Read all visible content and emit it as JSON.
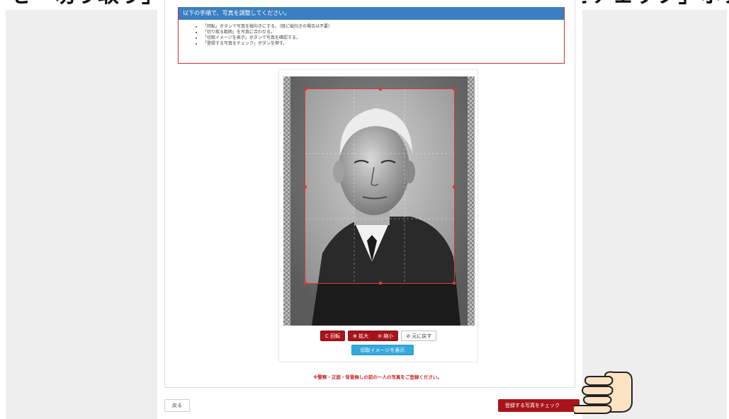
{
  "header": {
    "banner_text": "を「切り取り」ボタンで位置を調整して、「登録する写真をチェック」ボタン"
  },
  "instructions": {
    "title": "以下の手順で、写真を調整してください。",
    "items": [
      "「回転」ボタンで写真を縦向きにする。（既に縦向きの場合は不要）",
      "「切り取る範囲」を写真に合わせる。",
      "「切取イメージを表示」ボタンで写真を確認する。",
      "「登録する写真をチェック」ボタンを押す。"
    ]
  },
  "photo_tools": {
    "rotate": "C 回転",
    "zoom_in": "⊕ 拡大",
    "zoom_out": "⊖ 縮小",
    "reset": "⊘ 元に戻す",
    "preview": "切取イメージを表示"
  },
  "notice": "※警察・正面・背景無しの前の一人の写真をご登録ください。",
  "footer": {
    "back": "戻る",
    "next": "登録する写真をチェック"
  },
  "colors": {
    "accent_red": "#a8141c",
    "header_blue": "#3a7fc1",
    "preview_blue": "#35a9db",
    "crop_red": "#d83a3a"
  }
}
